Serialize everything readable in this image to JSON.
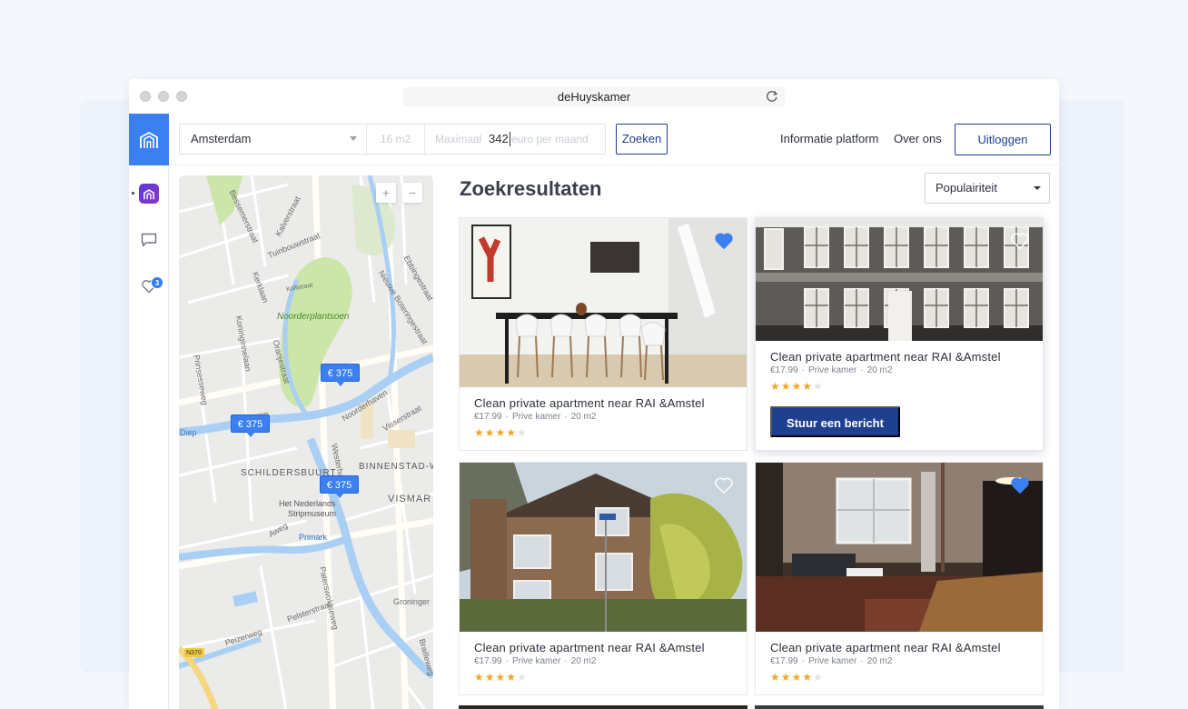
{
  "app": {
    "title": "deHuyskamer"
  },
  "sidebar": {
    "items": [
      {
        "name": "logo"
      },
      {
        "name": "app"
      },
      {
        "name": "messages"
      },
      {
        "name": "favorites",
        "badge": "3"
      }
    ]
  },
  "search": {
    "city": "Amsterdam",
    "size_placeholder": "16 m2",
    "price_placeholder": "Maximaal",
    "price_value": "342",
    "price_suffix": "euro per maand",
    "submit_label": "Zoeken"
  },
  "nav": {
    "info_label": "Informatie platform",
    "about_label": "Over ons",
    "logout_label": "Uitloggen"
  },
  "results": {
    "title": "Zoekresultaten",
    "sort_value": "Populairiteit",
    "action_label": "Stuur een bericht",
    "cards": [
      {
        "title": "Clean private apartment near RAI &Amstel",
        "price": "€17.99",
        "type": "Prive kamer",
        "size": "20 m2",
        "rating": 4,
        "favorited": true
      },
      {
        "title": "Clean private apartment near RAI &Amstel",
        "price": "€17.99",
        "type": "Prive kamer",
        "size": "20 m2",
        "rating": 4,
        "favorited": false
      },
      {
        "title": "Clean private apartment near RAI &Amstel",
        "price": "€17.99",
        "type": "Prive kamer",
        "size": "20 m2",
        "rating": 4,
        "favorited": false
      },
      {
        "title": "Clean private apartment near RAI &Amstel",
        "price": "€17.99",
        "type": "Prive kamer",
        "size": "20 m2",
        "rating": 4,
        "favorited": true
      }
    ]
  },
  "map": {
    "pins": [
      "€ 375",
      "€ 375",
      "€ 375"
    ],
    "labels": {
      "park": "Noorderplantsoen",
      "district1": "SCHILDERSBUURT",
      "district2": "BINNENSTAD-WE",
      "district3": "VISMAR",
      "museum": "Het Nederlands",
      "museum2": "Stripmuseum",
      "shop": "Primark",
      "city": "Groninger",
      "road": "N370",
      "s1": "Kalverstraat",
      "s2": "Tuinbouwstraat",
      "s3": "Bessemerstraat",
      "s4": "Prinsesseweg",
      "s5": "Koninginnelaan",
      "s6": "Noorderhaven",
      "s7": "Visserstraat",
      "s8": "Westerhaven",
      "s9": "Pelsterstraat",
      "s10": "Peizerweg",
      "s11": "Korreweg",
      "s12": "Nieuwe Boteringestraat",
      "s13": "Kerklaan",
      "s14": "Ebbingestraat",
      "s15": "Aweg",
      "s16": "Paterswoldseweg",
      "s17": "Kolfstraat",
      "s18": "Oranjestraat",
      "s19": "Diep",
      "s20": "Brailleweg"
    },
    "zoom_in": "+",
    "zoom_out": "−"
  },
  "colors": {
    "primary": "#3b7ff0",
    "navy": "#1f3f8f",
    "star": "#f5a623"
  }
}
